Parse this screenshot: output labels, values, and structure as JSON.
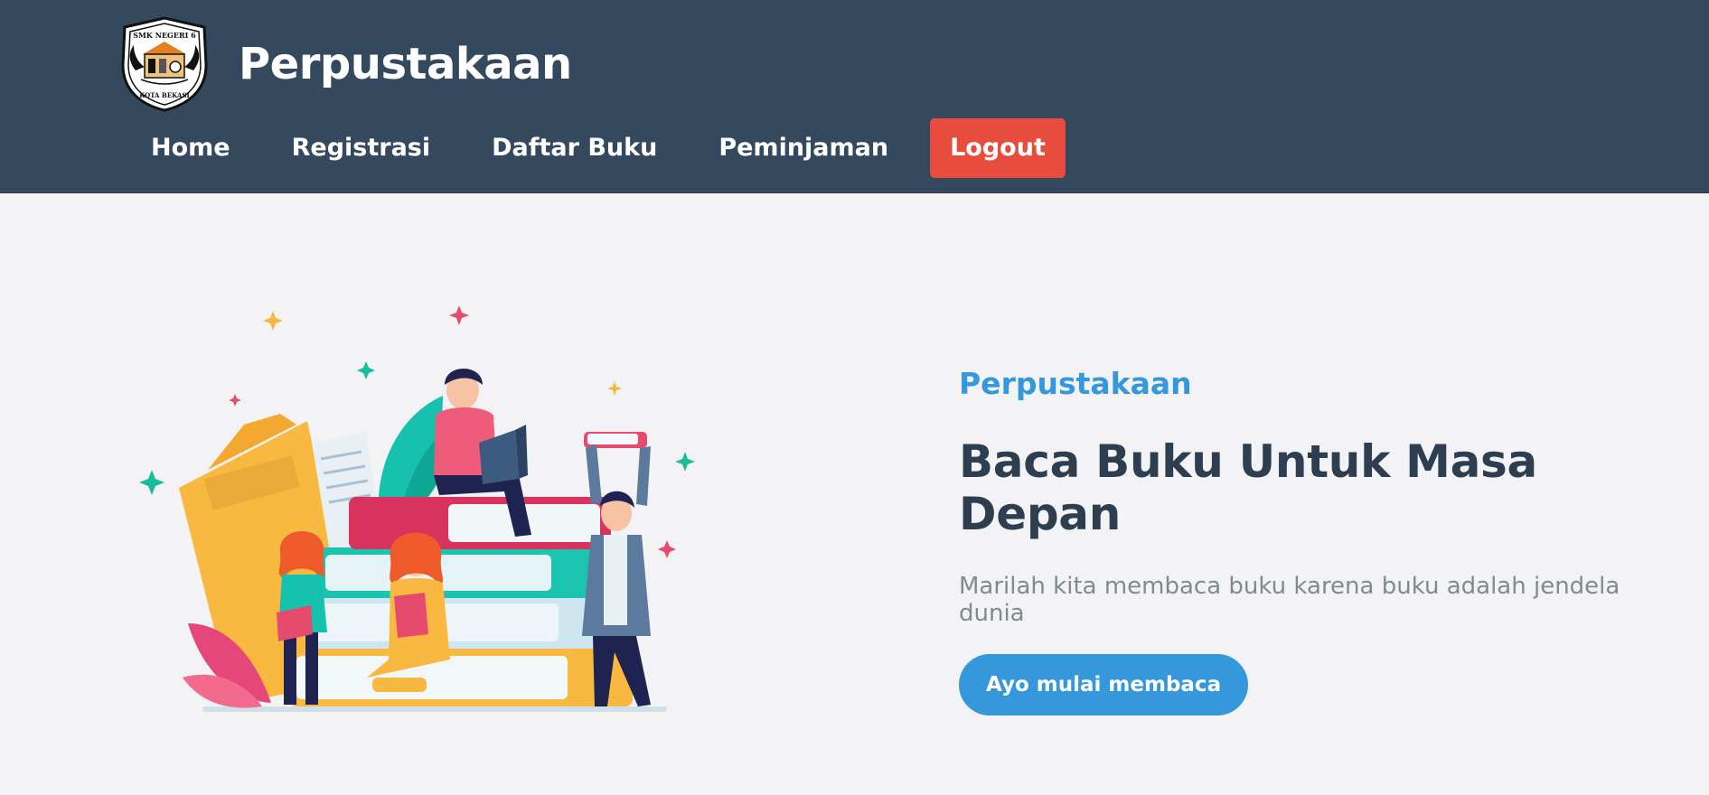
{
  "header": {
    "brand_title": "Perpustakaan",
    "logo": {
      "top_text": "SMK NEGERI 6",
      "bottom_text": "KOTA BEKASI",
      "icon": "school-crest-logo"
    }
  },
  "nav": {
    "items": [
      {
        "label": "Home"
      },
      {
        "label": "Registrasi"
      },
      {
        "label": "Daftar Buku"
      },
      {
        "label": "Peminjaman"
      }
    ],
    "logout_label": "Logout"
  },
  "hero": {
    "eyebrow": "Perpustakaan",
    "headline": "Baca Buku Untuk Masa Depan",
    "lead": "Marilah kita membaca buku karena buku adalah jendela dunia",
    "cta_label": "Ayo mulai membaca",
    "illustration": "people-reading-books-illustration"
  },
  "colors": {
    "header_bg": "#34495e",
    "logout_bg": "#e74c3c",
    "accent": "#3498db",
    "headline": "#2c3e50",
    "muted": "#7f8c8d",
    "page_bg": "#f3f3f5"
  }
}
